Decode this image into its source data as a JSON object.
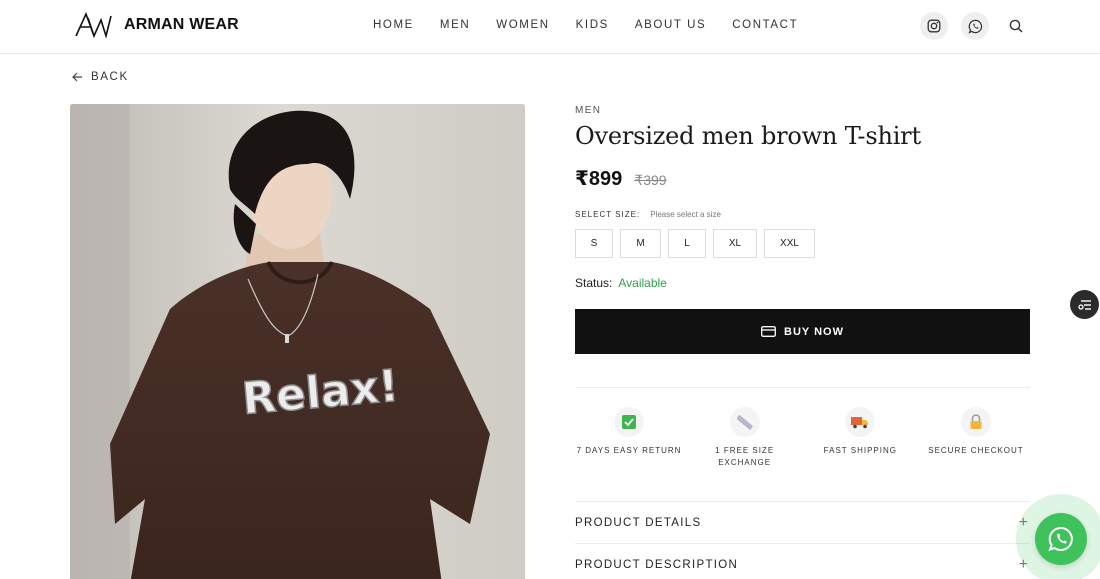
{
  "brand": {
    "name": "ARMAN WEAR",
    "logo_icon": "aw-monogram-icon"
  },
  "nav": {
    "items": [
      "HOME",
      "MEN",
      "WOMEN",
      "KIDS",
      "ABOUT US",
      "CONTACT"
    ]
  },
  "header_icons": [
    "instagram-icon",
    "whatsapp-icon",
    "search-icon"
  ],
  "back": {
    "label": "BACK"
  },
  "product": {
    "category": "MEN",
    "title": "Oversized men brown T-shirt",
    "price": "₹899",
    "mrp": "₹399",
    "graphic_text": "Relax!"
  },
  "size": {
    "label": "SELECT SIZE:",
    "hint": "Please select a size",
    "options": [
      "S",
      "M",
      "L",
      "XL",
      "XXL"
    ]
  },
  "status": {
    "label": "Status:",
    "value": "Available",
    "color": "#2e9e4a"
  },
  "buy_now": {
    "label": "BUY NOW"
  },
  "features": [
    {
      "icon": "check-box-icon",
      "lines": [
        "7 DAYS EASY RETURN"
      ]
    },
    {
      "icon": "ruler-icon",
      "lines": [
        "1 FREE SIZE",
        "EXCHANGE"
      ]
    },
    {
      "icon": "truck-icon",
      "lines": [
        "FAST SHIPPING"
      ]
    },
    {
      "icon": "lock-icon",
      "lines": [
        "SECURE CHECKOUT"
      ]
    }
  ],
  "accordions": [
    {
      "label": "PRODUCT DETAILS",
      "toggle": "+"
    },
    {
      "label": "PRODUCT DESCRIPTION",
      "toggle": "+"
    }
  ],
  "colors": {
    "accent": "#111111",
    "available": "#2e9e4a",
    "whatsapp": "#3fc25b"
  }
}
